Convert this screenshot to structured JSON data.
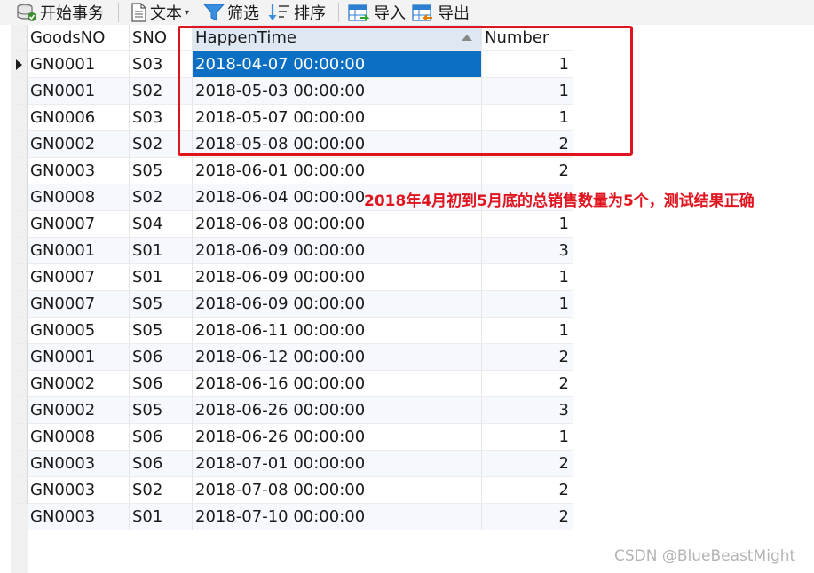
{
  "toolbar": {
    "items": [
      {
        "label": "开始事务",
        "icon": "database-transaction-icon"
      },
      {
        "label": "文本",
        "icon": "text-document-icon"
      },
      {
        "label": "筛选",
        "icon": "filter-icon"
      },
      {
        "label": "排序",
        "icon": "sort-icon"
      },
      {
        "label": "导入",
        "icon": "import-icon"
      },
      {
        "label": "导出",
        "icon": "export-icon"
      }
    ],
    "text_dropdown_caret": "▾"
  },
  "table": {
    "columns": [
      "GoodsNO",
      "SNO",
      "HappenTime",
      "Number"
    ],
    "sorted_column": "HappenTime",
    "sort_direction": "ascending",
    "rows": [
      [
        "GN0001",
        "S03",
        "2018-04-07 00:00:00",
        "1"
      ],
      [
        "GN0001",
        "S02",
        "2018-05-03 00:00:00",
        "1"
      ],
      [
        "GN0006",
        "S03",
        "2018-05-07 00:00:00",
        "1"
      ],
      [
        "GN0002",
        "S02",
        "2018-05-08 00:00:00",
        "2"
      ],
      [
        "GN0003",
        "S05",
        "2018-06-01 00:00:00",
        "2"
      ],
      [
        "GN0008",
        "S02",
        "2018-06-04 00:00:00",
        ""
      ],
      [
        "GN0007",
        "S04",
        "2018-06-08 00:00:00",
        "1"
      ],
      [
        "GN0001",
        "S01",
        "2018-06-09 00:00:00",
        "3"
      ],
      [
        "GN0007",
        "S01",
        "2018-06-09 00:00:00",
        "1"
      ],
      [
        "GN0007",
        "S05",
        "2018-06-09 00:00:00",
        "1"
      ],
      [
        "GN0005",
        "S05",
        "2018-06-11 00:00:00",
        "1"
      ],
      [
        "GN0001",
        "S06",
        "2018-06-12 00:00:00",
        "2"
      ],
      [
        "GN0002",
        "S06",
        "2018-06-16 00:00:00",
        "2"
      ],
      [
        "GN0002",
        "S05",
        "2018-06-26 00:00:00",
        "3"
      ],
      [
        "GN0008",
        "S06",
        "2018-06-26 00:00:00",
        "1"
      ],
      [
        "GN0003",
        "S06",
        "2018-07-01 00:00:00",
        "2"
      ],
      [
        "GN0003",
        "S02",
        "2018-07-08 00:00:00",
        "2"
      ],
      [
        "GN0003",
        "S01",
        "2018-07-10 00:00:00",
        "2"
      ]
    ],
    "selected_row": 0,
    "selected_column": "HappenTime"
  },
  "annotation": {
    "text": "2018年4月初到5月底的总销售数量为5个，测试结果正确",
    "color": "#e0141e"
  },
  "watermark": "CSDN @BlueBeastMight",
  "colors": {
    "selection": "#0b6fc4",
    "header_sorted": "#dde8f3",
    "highlight": "#e0141e"
  }
}
